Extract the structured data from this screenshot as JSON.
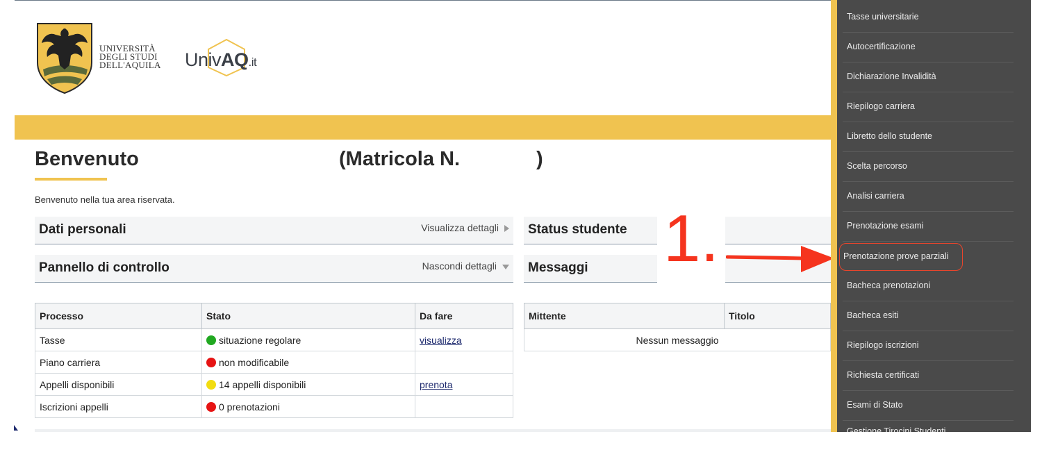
{
  "colors": {
    "accent_yellow": "#f0c350",
    "sidebar_bg": "#4a4a4a",
    "annotation_red": "#f5341e",
    "status_green": "#21a821",
    "status_red": "#e61414",
    "status_yellow": "#f2dc10",
    "link": "#1e2a6e"
  },
  "header": {
    "university_name_line1": "UNIVERSITÀ",
    "university_name_line2": "DEGLI STUDI",
    "university_name_line3": "DELL'AQUILA",
    "portal_logo_text_a": "Univ",
    "portal_logo_text_b": "AQ",
    "portal_logo_text_c": ".it"
  },
  "welcome": {
    "title": "Benvenuto",
    "matricola_label": "(Matricola N.",
    "matricola_close": ")",
    "subtitle": "Benvenuto nella tua area riservata."
  },
  "panels": {
    "dati_personali": {
      "title": "Dati personali",
      "action": "Visualizza dettagli"
    },
    "pannello": {
      "title": "Pannello di controllo",
      "action": "Nascondi dettagli"
    },
    "status": {
      "title": "Status studente"
    },
    "messaggi": {
      "title": "Messaggi"
    }
  },
  "process_table": {
    "headers": [
      "Processo",
      "Stato",
      "Da fare"
    ],
    "rows": [
      {
        "processo": "Tasse",
        "stato": "situazione regolare",
        "status_icon": "green-dot",
        "azione": "visualizza"
      },
      {
        "processo": "Piano carriera",
        "stato": "non modificabile",
        "status_icon": "red-dot",
        "azione": ""
      },
      {
        "processo": "Appelli disponibili",
        "stato": "14 appelli disponibili",
        "status_icon": "yellow-dot",
        "azione": "prenota"
      },
      {
        "processo": "Iscrizioni appelli",
        "stato": "0 prenotazioni",
        "status_icon": "red-dot",
        "azione": ""
      }
    ]
  },
  "message_table": {
    "headers": [
      "Mittente",
      "Titolo"
    ],
    "empty": "Nessun messaggio"
  },
  "annotation": {
    "label": "1."
  },
  "sidebar": {
    "items": [
      "Tasse universitarie",
      "Autocertificazione",
      "Dichiarazione Invalidità",
      "Riepilogo carriera",
      "Libretto dello studente",
      "Scelta percorso",
      "Analisi carriera",
      "Prenotazione esami",
      "Prenotazione prove parziali",
      "Bacheca prenotazioni",
      "Bacheca esiti",
      "Riepilogo iscrizioni",
      "Richiesta certificati",
      "Esami di Stato"
    ],
    "highlighted": "Prenotazione prove parziali",
    "cut_off_item": "Gestione Tirocini Studenti"
  }
}
